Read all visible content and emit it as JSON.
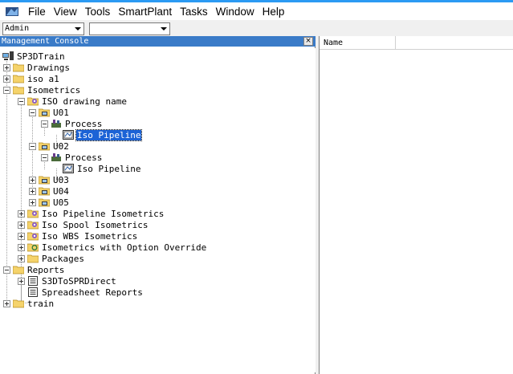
{
  "menubar": {
    "items": [
      "File",
      "View",
      "Tools",
      "SmartPlant",
      "Tasks",
      "Window",
      "Help"
    ]
  },
  "toolbar": {
    "combo1_value": "Admin",
    "combo2_value": ""
  },
  "console": {
    "title": "Management Console",
    "close_label": "×"
  },
  "tree": {
    "root": "SP3DTrain",
    "drawings": "Drawings",
    "iso_a1": "iso a1",
    "isometrics": "Isometrics",
    "iso_drawing_name": "ISO drawing name",
    "u01": "U01",
    "process1": "Process",
    "iso_pipeline1": "Iso Pipeline",
    "u02": "U02",
    "process2": "Process",
    "iso_pipeline2": "Iso Pipeline",
    "u03": "U03",
    "u04": "U04",
    "u05": "U05",
    "iso_pipeline_isometrics": "Iso Pipeline Isometrics",
    "iso_spool_isometrics": "Iso Spool Isometrics",
    "iso_wbs_isometrics": "Iso WBS Isometrics",
    "isometrics_option_override": "Isometrics with Option Override",
    "packages": "Packages",
    "reports": "Reports",
    "s3d_to_spr_direct": "S3DToSPRDirect",
    "spreadsheet_reports": "Spreadsheet Reports",
    "train": "train"
  },
  "list": {
    "column_name": "Name"
  },
  "colors": {
    "selection": "#1c63d6",
    "header": "#3a7bc8",
    "folder": "#f5d36b"
  }
}
